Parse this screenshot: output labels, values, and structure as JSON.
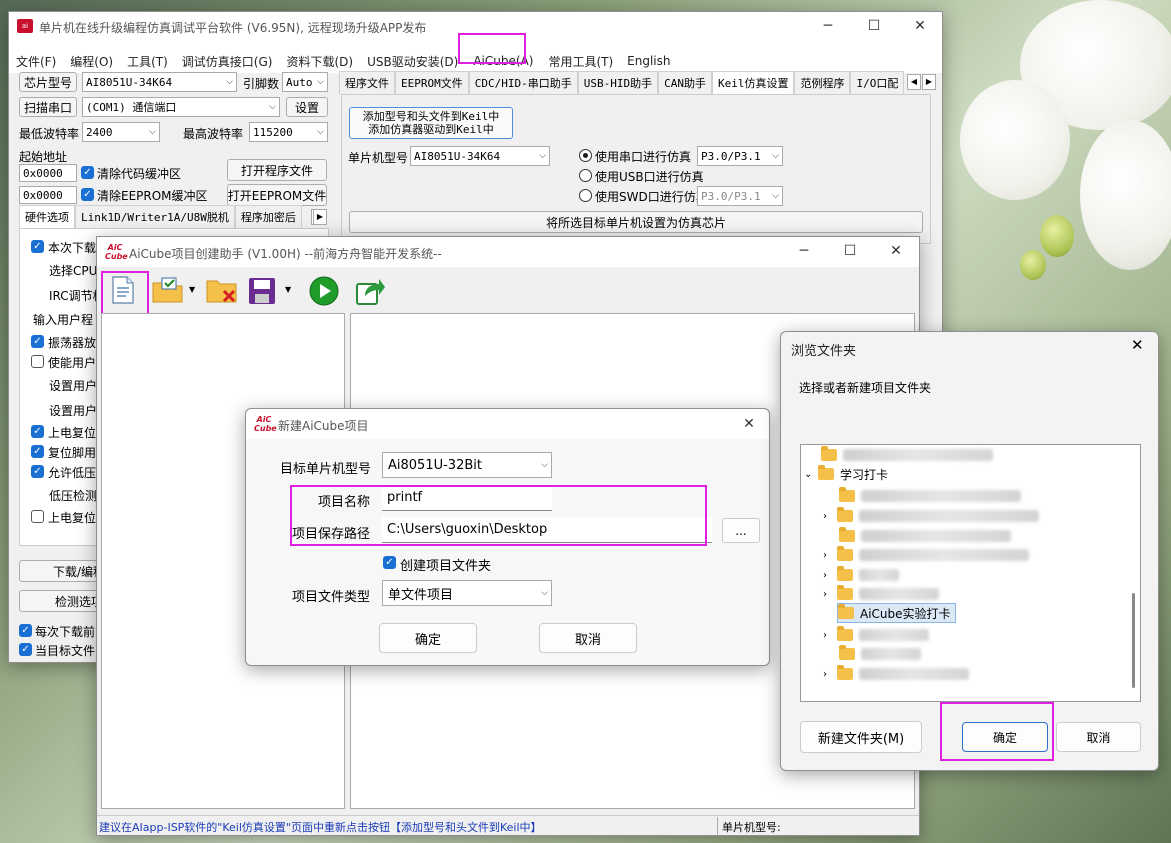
{
  "main": {
    "title": "单片机在线升级编程仿真调试平台软件 (V6.95N), 远程现场升级APP发布",
    "menus": [
      "文件(F)",
      "编程(O)",
      "工具(T)",
      "调试仿真接口(G)",
      "资料下载(D)",
      "USB驱动安装(D)",
      "AiCube(A)",
      "常用工具(T)",
      "English"
    ],
    "chip_label": "芯片型号",
    "chip_value": "AI8051U-34K64",
    "pin_label": "引脚数",
    "pin_value": "Auto",
    "scan_label": "扫描串口",
    "port_value": "(COM1) 通信端口",
    "settings_label": "设置",
    "min_baud_label": "最低波特率",
    "min_baud_value": "2400",
    "max_baud_label": "最高波特率",
    "max_baud_value": "115200",
    "start_addr_label": "起始地址",
    "addr1": "0x0000",
    "clear_code_label": "清除代码缓冲区",
    "open_prog_label": "打开程序文件",
    "addr2": "0x0000",
    "clear_eeprom_label": "清除EEPROM缓冲区",
    "open_eeprom_label": "打开EEPROM文件",
    "left_tabs": [
      "硬件选项",
      "Link1D/Writer1A/U8W脱机",
      "程序加密后"
    ],
    "options": [
      "本次下载",
      "选择CPU指",
      "IRC调节档",
      "输入用户程",
      "振荡器放",
      "使能用户",
      "设置用户",
      "设置用户",
      "上电复位",
      "复位脚用",
      "允许低压",
      "低压检测",
      "上电复位"
    ],
    "download_label": "下载/编程",
    "detect_label": "检测选项",
    "bottom_check1": "每次下载前",
    "bottom_check2": "当目标文件",
    "right_tabs": [
      "程序文件",
      "EEPROM文件",
      "CDC/HID-串口助手",
      "USB-HID助手",
      "CAN助手",
      "Keil仿真设置",
      "范例程序",
      "I/O口配"
    ],
    "add_keil_line1": "添加型号和头文件到Keil中",
    "add_keil_line2": "添加仿真器驱动到Keil中",
    "mcu_label": "单片机型号",
    "mcu_value": "AI8051U-34K64",
    "radio1": "使用串口进行仿真",
    "radio1_port": "P3.0/P3.1",
    "radio2": "使用USB口进行仿真",
    "radio3": "使用SWD口进行仿真",
    "radio3_port": "P3.0/P3.1",
    "set_emu_label": "将所选目标单片机设置为仿真芯片"
  },
  "aicube": {
    "title": "AiCube项目创建助手 (V1.00H) --前海方舟智能开发系统--",
    "logo_top": "AiC",
    "logo_bottom": "Cube",
    "status_text": "建议在AIapp-ISP软件的\"Keil仿真设置\"页面中重新点击按钮【添加型号和头文件到Keil中】",
    "status_right": "单片机型号:"
  },
  "new_project": {
    "title": "新建AiCube项目",
    "target_label": "目标单片机型号",
    "target_value": "Ai8051U-32Bit",
    "name_label": "项目名称",
    "name_value": "printf",
    "path_label": "项目保存路径",
    "path_value": "C:\\Users\\guoxin\\Desktop",
    "browse_label": "...",
    "create_folder_label": "创建项目文件夹",
    "type_label": "项目文件类型",
    "type_value": "单文件项目",
    "ok_label": "确定",
    "cancel_label": "取消"
  },
  "browse": {
    "title": "浏览文件夹",
    "prompt": "选择或者新建项目文件夹",
    "folder_study": "学习打卡",
    "folder_selected": "AiCube实验打卡",
    "new_folder_label": "新建文件夹(M)",
    "ok_label": "确定",
    "cancel_label": "取消"
  }
}
